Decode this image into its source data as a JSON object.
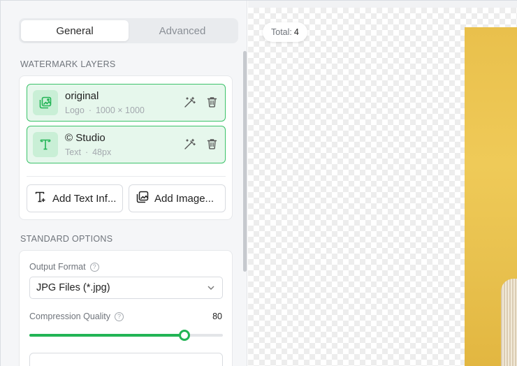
{
  "tabs": [
    {
      "label": "General",
      "active": true
    },
    {
      "label": "Advanced",
      "active": false
    }
  ],
  "watermark_layers": {
    "heading": "WATERMARK LAYERS",
    "layers": [
      {
        "name": "original",
        "type": "Logo",
        "detail": "1000 × 1000",
        "icon": "image-layer-icon"
      },
      {
        "name": "© Studio",
        "type": "Text",
        "detail": "48px",
        "icon": "text-layer-icon"
      }
    ],
    "separator": "·",
    "add_text_label": "Add Text Inf...",
    "add_image_label": "Add Image..."
  },
  "standard_options": {
    "heading": "STANDARD OPTIONS",
    "output_format_label": "Output Format",
    "output_format_value": "JPG Files (*.jpg)",
    "compression_label": "Compression Quality",
    "compression_value": "80",
    "compression_fraction": 0.8,
    "help_glyph": "?"
  },
  "preview": {
    "total_label": "Total:",
    "total_value": "4"
  },
  "colors": {
    "accent": "#22b455",
    "layer_bg": "#e6f7ec",
    "photo_bg": "#e9c04c"
  }
}
